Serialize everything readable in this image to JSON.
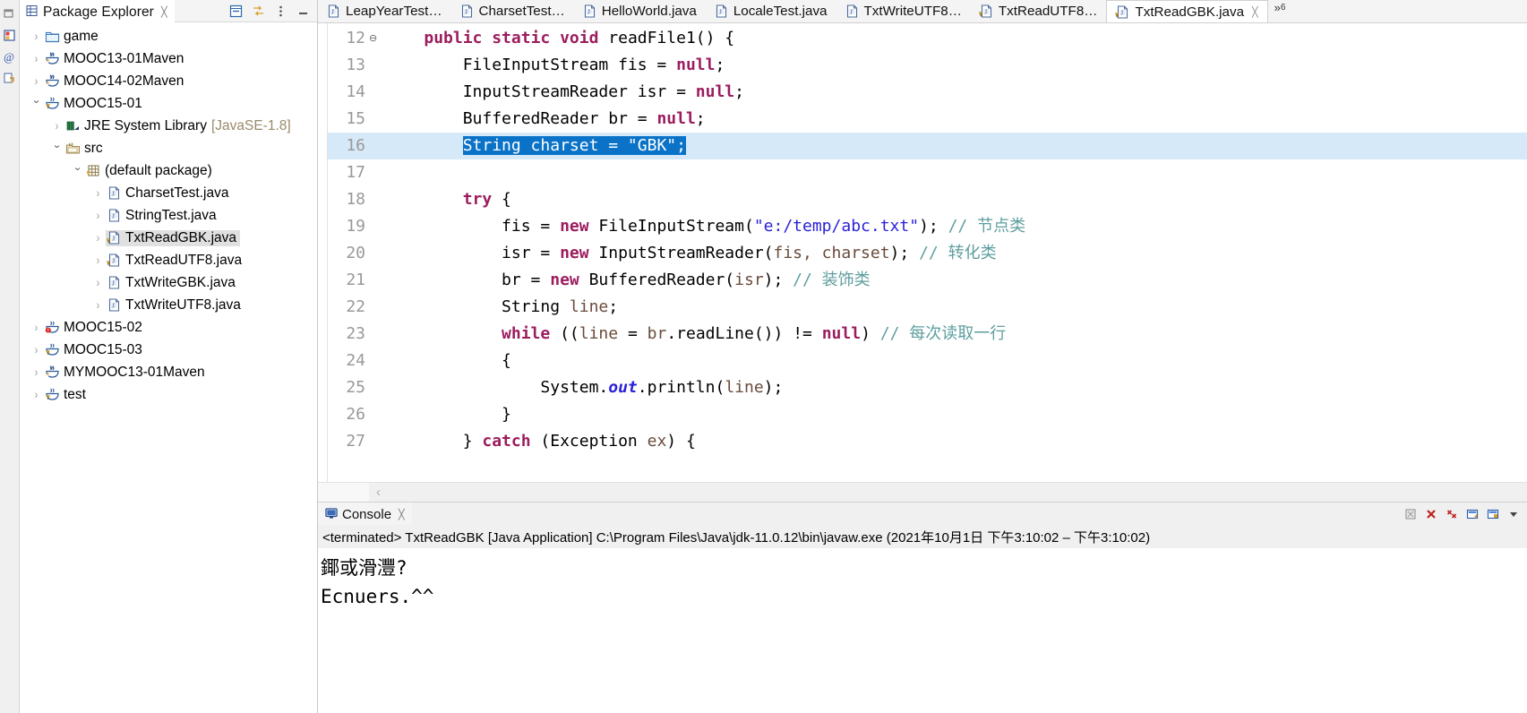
{
  "rail": {
    "icons": [
      {
        "name": "restore-perspective-icon",
        "glyph": "❐"
      },
      {
        "name": "package-explorer-view-icon",
        "glyph": "▣"
      },
      {
        "name": "annotation-view-icon",
        "glyph": "@"
      },
      {
        "name": "outline-view-icon",
        "glyph": "▤"
      }
    ]
  },
  "explorer": {
    "tab_label": "Package Explorer",
    "tab_close": "╳",
    "toolbar": [
      {
        "name": "collapse-all-icon",
        "title": "Collapse All"
      },
      {
        "name": "link-with-editor-icon",
        "title": "Link with Editor"
      },
      {
        "name": "view-menu-icon",
        "title": "View Menu"
      },
      {
        "name": "minimize-icon",
        "title": "Minimize"
      }
    ],
    "tree": [
      {
        "label": "game",
        "icon": "folder-icon",
        "indent": 0,
        "twisty": "collapsed",
        "selected": false,
        "suffix": ""
      },
      {
        "label": "MOOC13-01Maven",
        "icon": "maven-project-icon",
        "indent": 0,
        "twisty": "collapsed",
        "selected": false,
        "suffix": ""
      },
      {
        "label": "MOOC14-02Maven",
        "icon": "maven-project-icon",
        "indent": 0,
        "twisty": "collapsed",
        "selected": false,
        "suffix": ""
      },
      {
        "label": "MOOC15-01",
        "icon": "java-project-icon",
        "indent": 0,
        "twisty": "expanded",
        "selected": false,
        "suffix": ""
      },
      {
        "label": "JRE System Library",
        "icon": "library-icon",
        "indent": 1,
        "twisty": "collapsed",
        "selected": false,
        "suffix": "[JavaSE-1.8]"
      },
      {
        "label": "src",
        "icon": "source-folder-icon",
        "indent": 1,
        "twisty": "expanded",
        "selected": false,
        "suffix": ""
      },
      {
        "label": "(default package)",
        "icon": "package-icon",
        "indent": 2,
        "twisty": "expanded",
        "selected": false,
        "suffix": ""
      },
      {
        "label": "CharsetTest.java",
        "icon": "java-file-icon",
        "indent": 3,
        "twisty": "collapsed",
        "selected": false,
        "suffix": ""
      },
      {
        "label": "StringTest.java",
        "icon": "java-file-icon",
        "indent": 3,
        "twisty": "collapsed",
        "selected": false,
        "suffix": ""
      },
      {
        "label": "TxtReadGBK.java",
        "icon": "java-file-warning-icon",
        "indent": 3,
        "twisty": "collapsed",
        "selected": true,
        "suffix": ""
      },
      {
        "label": "TxtReadUTF8.java",
        "icon": "java-file-warning-icon",
        "indent": 3,
        "twisty": "collapsed",
        "selected": false,
        "suffix": ""
      },
      {
        "label": "TxtWriteGBK.java",
        "icon": "java-file-icon",
        "indent": 3,
        "twisty": "collapsed",
        "selected": false,
        "suffix": ""
      },
      {
        "label": "TxtWriteUTF8.java",
        "icon": "java-file-icon",
        "indent": 3,
        "twisty": "collapsed",
        "selected": false,
        "suffix": ""
      },
      {
        "label": "MOOC15-02",
        "icon": "java-project-error-icon",
        "indent": 0,
        "twisty": "collapsed",
        "selected": false,
        "suffix": ""
      },
      {
        "label": "MOOC15-03",
        "icon": "java-project-icon",
        "indent": 0,
        "twisty": "collapsed",
        "selected": false,
        "suffix": ""
      },
      {
        "label": "MYMOOC13-01Maven",
        "icon": "maven-project-icon",
        "indent": 0,
        "twisty": "collapsed",
        "selected": false,
        "suffix": ""
      },
      {
        "label": "test",
        "icon": "java-project-icon",
        "indent": 0,
        "twisty": "collapsed",
        "selected": false,
        "suffix": ""
      }
    ]
  },
  "editor": {
    "tabs": [
      {
        "label": "LeapYearTest…",
        "icon": "java-file-icon",
        "active": false,
        "closable": false
      },
      {
        "label": "CharsetTest…",
        "icon": "java-file-icon",
        "active": false,
        "closable": false
      },
      {
        "label": "HelloWorld.java",
        "icon": "java-file-icon",
        "active": false,
        "closable": false
      },
      {
        "label": "LocaleTest.java",
        "icon": "java-file-icon",
        "active": false,
        "closable": false
      },
      {
        "label": "TxtWriteUTF8…",
        "icon": "java-file-icon",
        "active": false,
        "closable": false
      },
      {
        "label": "TxtReadUTF8…",
        "icon": "java-file-warning-icon",
        "active": false,
        "closable": false
      },
      {
        "label": "TxtReadGBK.java",
        "icon": "java-file-warning-icon",
        "active": true,
        "closable": true
      }
    ],
    "tab_close": "╳",
    "overflow_label": "»",
    "overflow_count": "6",
    "first_line_number": 12,
    "lines": [
      {
        "n": "12",
        "fold": "⊖",
        "highlight": false,
        "tokens": [
          {
            "t": "    ",
            "c": "plain"
          },
          {
            "t": "public static void ",
            "c": "kw"
          },
          {
            "t": "readFile1() {",
            "c": "plain"
          }
        ]
      },
      {
        "n": "13",
        "fold": "",
        "highlight": false,
        "tokens": [
          {
            "t": "        FileInputStream fis = ",
            "c": "plain"
          },
          {
            "t": "null",
            "c": "kw"
          },
          {
            "t": ";",
            "c": "plain"
          }
        ]
      },
      {
        "n": "14",
        "fold": "",
        "highlight": false,
        "tokens": [
          {
            "t": "        InputStreamReader isr = ",
            "c": "plain"
          },
          {
            "t": "null",
            "c": "kw"
          },
          {
            "t": ";",
            "c": "plain"
          }
        ]
      },
      {
        "n": "15",
        "fold": "",
        "highlight": false,
        "tokens": [
          {
            "t": "        BufferedReader br = ",
            "c": "plain"
          },
          {
            "t": "null",
            "c": "kw"
          },
          {
            "t": ";",
            "c": "plain"
          }
        ]
      },
      {
        "n": "16",
        "fold": "",
        "highlight": true,
        "selection": "String charset = \"GBK\";",
        "tokens": [
          {
            "t": "        ",
            "c": "plain"
          },
          {
            "t": "String charset = \"GBK\";",
            "c": "sel"
          }
        ]
      },
      {
        "n": "17",
        "fold": "",
        "highlight": false,
        "tokens": [
          {
            "t": "",
            "c": "plain"
          }
        ]
      },
      {
        "n": "18",
        "fold": "",
        "highlight": false,
        "tokens": [
          {
            "t": "        ",
            "c": "plain"
          },
          {
            "t": "try",
            "c": "kw"
          },
          {
            "t": " {",
            "c": "plain"
          }
        ]
      },
      {
        "n": "19",
        "fold": "",
        "highlight": false,
        "tokens": [
          {
            "t": "            fis = ",
            "c": "plain"
          },
          {
            "t": "new",
            "c": "kw"
          },
          {
            "t": " FileInputStream(",
            "c": "plain"
          },
          {
            "t": "\"e:/temp/abc.txt\"",
            "c": "str"
          },
          {
            "t": "); ",
            "c": "plain"
          },
          {
            "t": "// 节点类",
            "c": "cmt"
          }
        ]
      },
      {
        "n": "20",
        "fold": "",
        "highlight": false,
        "tokens": [
          {
            "t": "            isr = ",
            "c": "plain"
          },
          {
            "t": "new",
            "c": "kw"
          },
          {
            "t": " InputStreamReader(",
            "c": "plain"
          },
          {
            "t": "fis, charset",
            "c": "var"
          },
          {
            "t": "); ",
            "c": "plain"
          },
          {
            "t": "// 转化类",
            "c": "cmt"
          }
        ]
      },
      {
        "n": "21",
        "fold": "",
        "highlight": false,
        "tokens": [
          {
            "t": "            br = ",
            "c": "plain"
          },
          {
            "t": "new",
            "c": "kw"
          },
          {
            "t": " BufferedReader(",
            "c": "plain"
          },
          {
            "t": "isr",
            "c": "var"
          },
          {
            "t": "); ",
            "c": "plain"
          },
          {
            "t": "// 装饰类",
            "c": "cmt"
          }
        ]
      },
      {
        "n": "22",
        "fold": "",
        "highlight": false,
        "tokens": [
          {
            "t": "            String ",
            "c": "plain"
          },
          {
            "t": "line",
            "c": "var"
          },
          {
            "t": ";",
            "c": "plain"
          }
        ]
      },
      {
        "n": "23",
        "fold": "",
        "highlight": false,
        "tokens": [
          {
            "t": "            ",
            "c": "plain"
          },
          {
            "t": "while",
            "c": "kw"
          },
          {
            "t": " ((",
            "c": "plain"
          },
          {
            "t": "line",
            "c": "var"
          },
          {
            "t": " = ",
            "c": "plain"
          },
          {
            "t": "br",
            "c": "var"
          },
          {
            "t": ".readLine()) != ",
            "c": "plain"
          },
          {
            "t": "null",
            "c": "kw"
          },
          {
            "t": ") ",
            "c": "plain"
          },
          {
            "t": "// 每次读取一行",
            "c": "cmt"
          }
        ]
      },
      {
        "n": "24",
        "fold": "",
        "highlight": false,
        "tokens": [
          {
            "t": "            {",
            "c": "plain"
          }
        ]
      },
      {
        "n": "25",
        "fold": "",
        "highlight": false,
        "tokens": [
          {
            "t": "                System.",
            "c": "plain"
          },
          {
            "t": "out",
            "c": "fld"
          },
          {
            "t": ".println(",
            "c": "plain"
          },
          {
            "t": "line",
            "c": "var"
          },
          {
            "t": ");",
            "c": "plain"
          }
        ]
      },
      {
        "n": "26",
        "fold": "",
        "highlight": false,
        "tokens": [
          {
            "t": "            }",
            "c": "plain"
          }
        ]
      },
      {
        "n": "27",
        "fold": "",
        "highlight": false,
        "tokens": [
          {
            "t": "        } ",
            "c": "plain"
          },
          {
            "t": "catch",
            "c": "kw"
          },
          {
            "t": " (Exception ",
            "c": "plain"
          },
          {
            "t": "ex",
            "c": "var"
          },
          {
            "t": ") {",
            "c": "plain"
          }
        ]
      }
    ],
    "hscroll_left_arrow": "‹"
  },
  "console": {
    "tab_label": "Console",
    "tab_close": "╳",
    "tools": [
      {
        "name": "clear-console-icon"
      },
      {
        "name": "terminate-icon"
      },
      {
        "name": "remove-launch-icon"
      },
      {
        "name": "display-selected-console-icon"
      },
      {
        "name": "pin-console-icon"
      },
      {
        "name": "view-menu-icon"
      }
    ],
    "status_line": "<terminated> TxtReadGBK [Java Application] C:\\Program Files\\Java\\jdk-11.0.12\\bin\\javaw.exe  (2021年10月1日 下午3:10:02 – 下午3:10:02)",
    "output": [
      "鎁或滑灃?",
      "Ecnuers.^^"
    ]
  },
  "colors": {
    "selection_blue": "#0a73c8",
    "line_highlight": "#d6e9f8",
    "keyword": "#9c1d5e",
    "string": "#2a22d8",
    "comment": "#5f9e9e",
    "gutter_text": "#999999",
    "tree_selection": "#e0e0e0"
  }
}
